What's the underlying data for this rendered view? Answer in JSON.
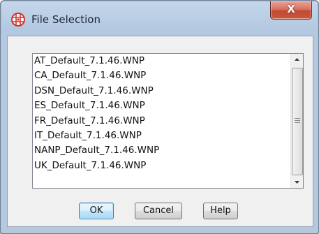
{
  "window": {
    "title": "File Selection",
    "app_icon": "globe-grid-icon",
    "close_icon": "close-icon",
    "close_label": "X"
  },
  "file_list": {
    "items": [
      "AT_Default_7.1.46.WNP",
      "CA_Default_7.1.46.WNP",
      "DSN_Default_7.1.46.WNP",
      "ES_Default_7.1.46.WNP",
      "FR_Default_7.1.46.WNP",
      "IT_Default_7.1.46.WNP",
      "NANP_Default_7.1.46.WNP",
      "UK_Default_7.1.46.WNP"
    ],
    "scroll_position": 0.0
  },
  "buttons": {
    "ok_label": "OK",
    "cancel_label": "Cancel",
    "help_label": "Help"
  },
  "colors": {
    "titlebar": "#bcd0e6",
    "close_button": "#c8563d",
    "app_icon": "#d0352a",
    "default_button_border": "#3c7fb1"
  }
}
